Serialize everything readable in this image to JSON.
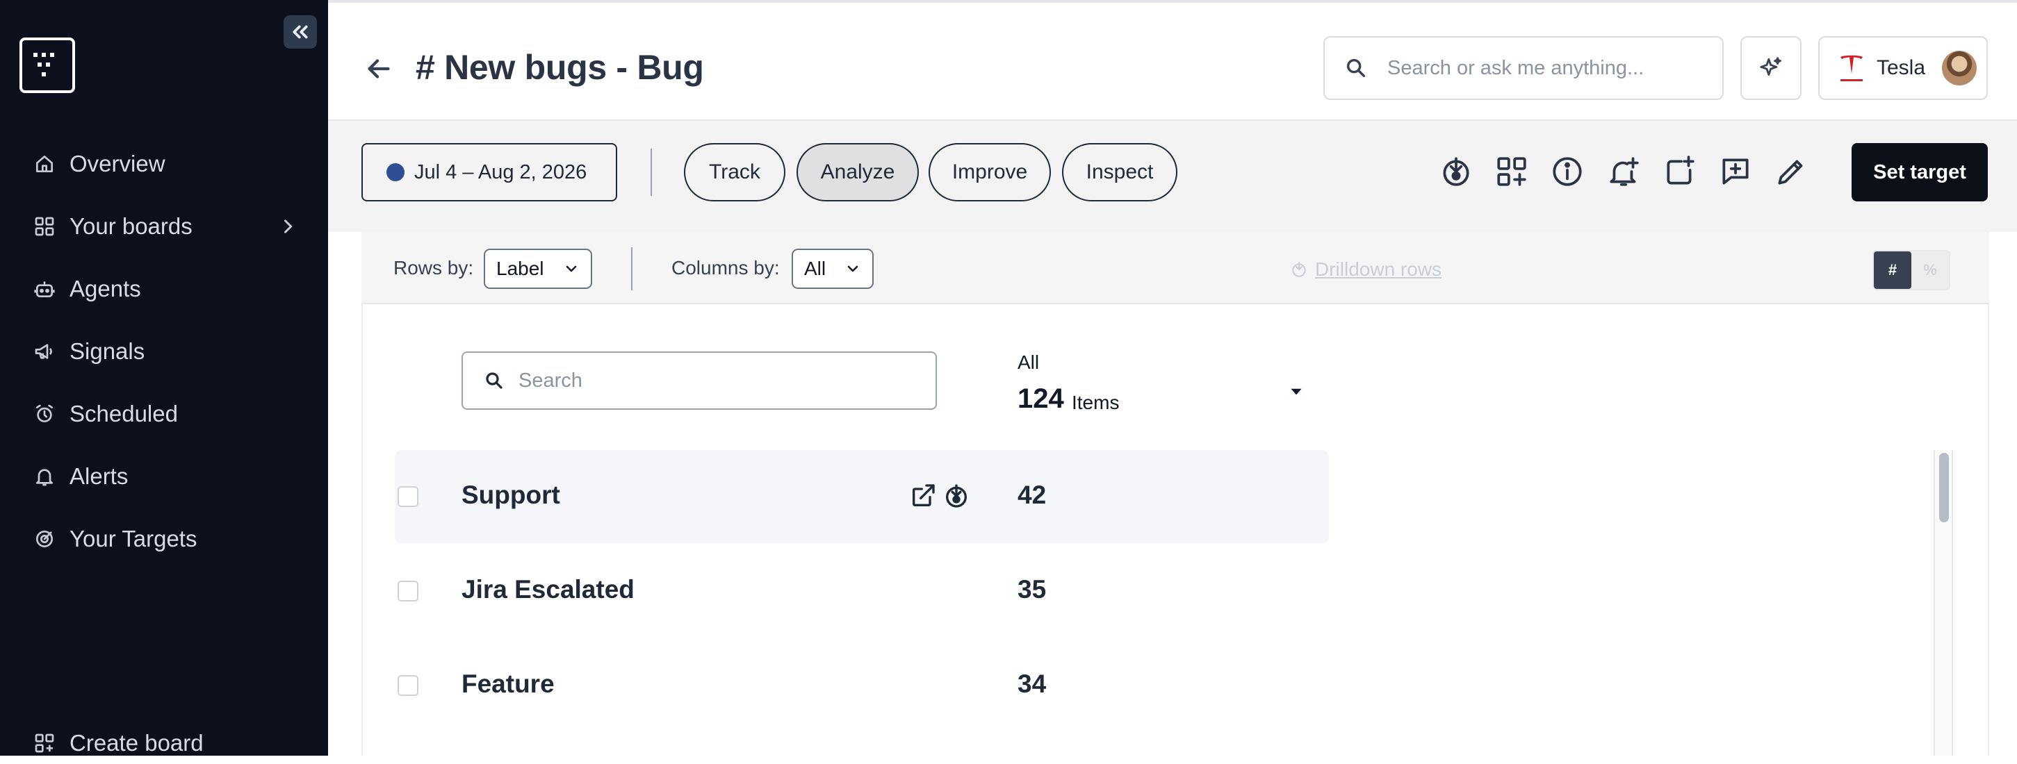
{
  "sidebar": {
    "items": [
      {
        "label": "Overview",
        "icon": "home-icon"
      },
      {
        "label": "Your boards",
        "icon": "grid-icon"
      },
      {
        "label": "Agents",
        "icon": "robot-icon"
      },
      {
        "label": "Signals",
        "icon": "megaphone-icon"
      },
      {
        "label": "Scheduled",
        "icon": "alarm-clock-icon"
      },
      {
        "label": "Alerts",
        "icon": "bell-icon"
      },
      {
        "label": "Your Targets",
        "icon": "target-icon"
      }
    ],
    "create_board": "Create board"
  },
  "header": {
    "title": "# New bugs - Bug",
    "search_placeholder": "Search or ask me anything...",
    "account_name": "Tesla"
  },
  "toolbar": {
    "date_range": "Jul 4 – Aug 2, 2026",
    "date_dot_color": "#2f4f95",
    "tabs": [
      {
        "label": "Track",
        "active": false
      },
      {
        "label": "Analyze",
        "active": true
      },
      {
        "label": "Improve",
        "active": false
      },
      {
        "label": "Inspect",
        "active": false
      }
    ],
    "set_target_label": "Set target"
  },
  "controls": {
    "rows_by_label": "Rows by:",
    "rows_by_value": "Label",
    "columns_by_label": "Columns by:",
    "columns_by_value": "All",
    "drilldown_label": "Drilldown rows",
    "toggle_count": "#",
    "toggle_percent": "%"
  },
  "list": {
    "search_placeholder": "Search",
    "column_title": "All",
    "total_count": "124",
    "total_unit": "Items",
    "rows": [
      {
        "label": "Support",
        "value": "42"
      },
      {
        "label": "Jira Escalated",
        "value": "35"
      },
      {
        "label": "Feature",
        "value": "34"
      }
    ]
  },
  "colors": {
    "sidebar_bg": "#0b101c",
    "primary_button": "#0b0f17"
  }
}
